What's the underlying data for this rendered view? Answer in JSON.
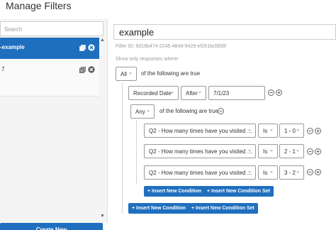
{
  "app": {
    "title": "Manage Filters"
  },
  "sidebar": {
    "search_placeholder": "Search",
    "items": [
      {
        "label": "-example",
        "active": true
      },
      {
        "label": "7",
        "active": false
      }
    ],
    "create_new_label": "Create New"
  },
  "main": {
    "filter_name": "example",
    "filter_id_text": "Filter ID: 9d18b474-2245-4848-9429-ef281bcfd56f",
    "show_only_text": "Show only responses where:",
    "root": {
      "conjunction": "All",
      "suffix_text": "of the following are true"
    },
    "date_condition": {
      "field": "Recorded Date",
      "operator": "After",
      "value": "7/1/23"
    },
    "subgroup": {
      "conjunction": "Any",
      "suffix_text": "of the following are true"
    },
    "conditions": [
      {
        "question": "Q2 - How many times have you visited ...",
        "operator": "Is",
        "value": "1 - 0"
      },
      {
        "question": "Q2 - How many times have you visited ...",
        "operator": "Is",
        "value": "2 - 1"
      },
      {
        "question": "Q2 - How many times have you visited ...",
        "operator": "Is",
        "value": "3 - 2"
      }
    ],
    "buttons": {
      "insert_condition": "+ Insert New Condition",
      "insert_condition_set": "+ Insert New Condition Set"
    }
  },
  "colors": {
    "primary": "#1f6fbf",
    "border": "#9a9a9a"
  },
  "icons": [
    "copy-icon",
    "remove-icon",
    "minus-circle-icon",
    "plus-circle-icon",
    "chevron-down-icon"
  ]
}
